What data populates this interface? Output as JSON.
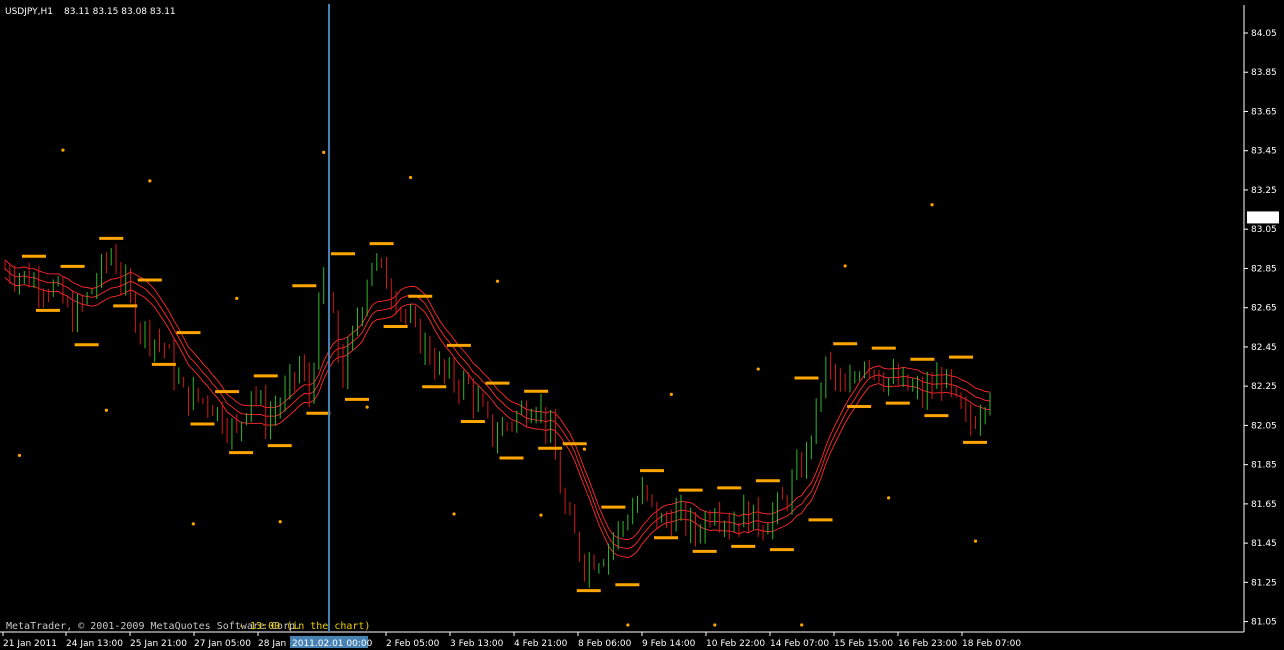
{
  "window": {
    "symbol_label": "USDJPY,H1",
    "ohlc_label": "83.11 83.15 83.08 83.11",
    "watermark_text": "MetaTrader, © 2001-2009 MetaQuotes Software Corp.",
    "session_text": "- 13:00 (in the chart)",
    "current_price_label": "83.11"
  },
  "colors": {
    "background": "#000000",
    "frame": "#ffffff",
    "bull_bar": "#2fb82f",
    "bear_bar": "#d11a1a",
    "moving_average": "#ff2a2a",
    "level_marker": "#ffa500",
    "fractal_dot": "#ffa500",
    "cursor_line": "#4682b4",
    "session_text": "#f0d000"
  },
  "chart_data": {
    "type": "candlestick",
    "title": "USDJPY,H1",
    "ylim": [
      80.98,
      84.16
    ],
    "y_ticks": [
      "84.05",
      "83.85",
      "83.65",
      "83.45",
      "83.25",
      "83.05",
      "82.85",
      "82.65",
      "82.45",
      "82.25",
      "82.05",
      "81.85",
      "81.65",
      "81.45",
      "81.25",
      "81.05"
    ],
    "x_ticks": [
      "21 Jan 2011",
      "24 Jan 13:00",
      "25 Jan 21:00",
      "27 Jan 05:00",
      "28 Jan",
      "2 Feb 05:00",
      "3 Feb 13:00",
      "4 Feb 21:00",
      "8 Feb 06:00",
      "9 Feb 14:00",
      "10 Feb 22:00",
      "14 Feb 07:00",
      "15 Feb 15:00",
      "16 Feb 23:00",
      "18 Feb 07:00"
    ],
    "x_cursor_label": "2011.02.01 00:00",
    "cursor_bar_index": 68,
    "bar_count": 205,
    "bars_anchor": [
      [
        0,
        82.85
      ],
      [
        5,
        82.8
      ],
      [
        10,
        82.75
      ],
      [
        14,
        82.6
      ],
      [
        17,
        82.7
      ],
      [
        22,
        82.93
      ],
      [
        28,
        82.55
      ],
      [
        33,
        82.45
      ],
      [
        37,
        82.2
      ],
      [
        42,
        82.18
      ],
      [
        48,
        82.0
      ],
      [
        51,
        82.25
      ],
      [
        54,
        82.08
      ],
      [
        58,
        82.2
      ],
      [
        61,
        82.35
      ],
      [
        63,
        82.2
      ],
      [
        66,
        82.82
      ],
      [
        70,
        82.3
      ],
      [
        76,
        82.9
      ],
      [
        80,
        82.75
      ],
      [
        84,
        82.55
      ],
      [
        87,
        82.45
      ],
      [
        91,
        82.3
      ],
      [
        96,
        82.25
      ],
      [
        101,
        82.0
      ],
      [
        106,
        82.1
      ],
      [
        110,
        82.18
      ],
      [
        113,
        82.0
      ],
      [
        116,
        81.6
      ],
      [
        120,
        81.35
      ],
      [
        124,
        81.4
      ],
      [
        128,
        81.55
      ],
      [
        132,
        81.7
      ],
      [
        136,
        81.55
      ],
      [
        139,
        81.6
      ],
      [
        143,
        81.5
      ],
      [
        147,
        81.65
      ],
      [
        150,
        81.55
      ],
      [
        153,
        81.6
      ],
      [
        157,
        81.55
      ],
      [
        161,
        81.65
      ],
      [
        166,
        81.9
      ],
      [
        170,
        82.35
      ],
      [
        174,
        82.2
      ],
      [
        178,
        82.4
      ],
      [
        182,
        82.3
      ],
      [
        186,
        82.25
      ],
      [
        190,
        82.2
      ],
      [
        194,
        82.3
      ],
      [
        198,
        82.1
      ],
      [
        200,
        82.05
      ],
      [
        204,
        82.25
      ]
    ],
    "note": "anchor points give bar_index and approximate close price"
  }
}
